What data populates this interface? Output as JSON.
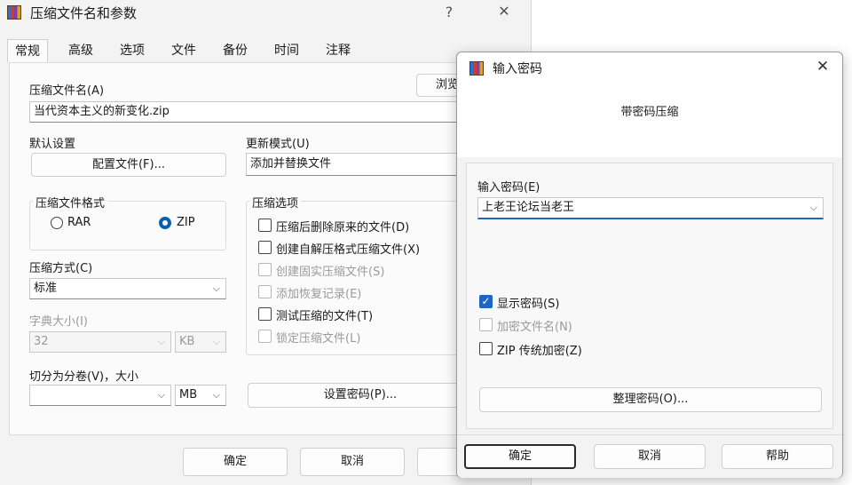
{
  "main_window": {
    "title": "压缩文件名和参数",
    "help_glyph": "?",
    "close_glyph": "✕",
    "tabs": [
      "常规",
      "高级",
      "选项",
      "文件",
      "备份",
      "时间",
      "注释"
    ],
    "archive_name_label": "压缩文件名(A)",
    "archive_name_value": "当代资本主义的新变化.zip",
    "browse_button": "浏览",
    "default_settings_label": "默认设置",
    "profiles_button": "配置文件(F)...",
    "update_mode_label": "更新模式(U)",
    "update_mode_value": "添加并替换文件",
    "format_group_title": "压缩文件格式",
    "format_rar": "RAR",
    "format_zip": "ZIP",
    "method_label": "压缩方式(C)",
    "method_value": "标准",
    "dict_label": "字典大小(I)",
    "dict_value": "32",
    "dict_unit": "KB",
    "split_label": "切分为分卷(V)，大小",
    "split_value": "",
    "split_unit": "MB",
    "options_group_title": "压缩选项",
    "options": [
      {
        "label": "压缩后删除原来的文件(D)",
        "checked": false,
        "enabled": true
      },
      {
        "label": "创建自解压格式压缩文件(X)",
        "checked": false,
        "enabled": true
      },
      {
        "label": "创建固实压缩文件(S)",
        "checked": false,
        "enabled": false
      },
      {
        "label": "添加恢复记录(E)",
        "checked": false,
        "enabled": false
      },
      {
        "label": "测试压缩的文件(T)",
        "checked": false,
        "enabled": true
      },
      {
        "label": "锁定压缩文件(L)",
        "checked": false,
        "enabled": false
      }
    ],
    "set_password_button": "设置密码(P)...",
    "ok_button": "确定",
    "cancel_button": "取消"
  },
  "password_dialog": {
    "title": "输入密码",
    "close_glyph": "✕",
    "heading": "带密码压缩",
    "password_label": "输入密码(E)",
    "password_value": "上老王论坛当老王",
    "show_password": {
      "label": "显示密码(S)",
      "checked": true
    },
    "encrypt_names": {
      "label": "加密文件名(N)",
      "checked": false
    },
    "zip_legacy": {
      "label": "ZIP 传统加密(Z)",
      "checked": false
    },
    "organize_button": "整理密码(O)...",
    "ok_button": "确定",
    "cancel_button": "取消",
    "help_button": "帮助"
  },
  "colors": {
    "accent": "#1f66c4",
    "window_bg": "#f3f3f3"
  }
}
